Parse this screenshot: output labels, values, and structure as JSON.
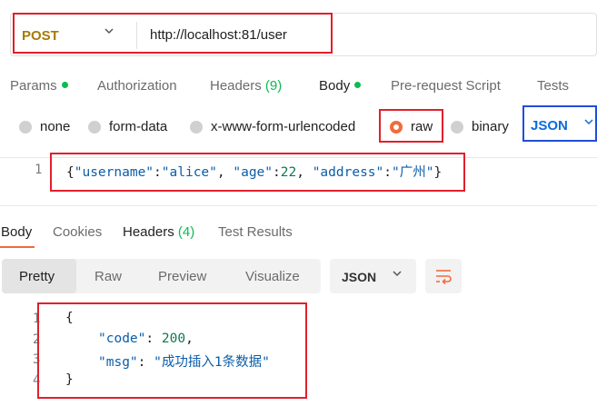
{
  "request": {
    "method": "POST",
    "url": "http://localhost:81/user"
  },
  "request_tabs": {
    "params": "Params",
    "authorization": "Authorization",
    "headers": "Headers",
    "headers_count": "(9)",
    "body": "Body",
    "prerequest": "Pre-request Script",
    "tests": "Tests"
  },
  "body_types": {
    "none": "none",
    "form_data": "form-data",
    "urlencoded": "x-www-form-urlencoded",
    "raw": "raw",
    "binary": "binary",
    "format": "JSON"
  },
  "editor": {
    "line1": "1",
    "p1": "{",
    "k1": "\"username\"",
    "c1": ":",
    "v1": "\"alice\"",
    "s1": ",",
    "k2": "\"age\"",
    "c2": ":",
    "v2": "22",
    "s2": ",",
    "k3": "\"address\"",
    "c3": ":",
    "v3": "\"广州\"",
    "p2": "}"
  },
  "response_tabs": {
    "body": "Body",
    "cookies": "Cookies",
    "headers": "Headers",
    "headers_count": "(4)",
    "test_results": "Test Results"
  },
  "response_view": {
    "pretty": "Pretty",
    "raw": "Raw",
    "preview": "Preview",
    "visualize": "Visualize",
    "format": "JSON"
  },
  "response": {
    "lines": [
      "1",
      "2",
      "3",
      "4"
    ],
    "open": "{",
    "code_key": "\"code\"",
    "code_colon": ":",
    "code_val": "200",
    "code_comma": ",",
    "msg_key": "\"msg\"",
    "msg_colon": ":",
    "msg_val": "\"成功插入1条数据\"",
    "close": "}"
  },
  "colors": {
    "highlight": "#e0202b",
    "highlight_blue": "#1f4fd6",
    "accent": "#f26b3a",
    "active_dot": "#0cbb52"
  },
  "icons": {
    "method_dropdown": "chevron-down-icon",
    "format_dropdown": "chevron-down-icon",
    "wrap": "wrap-lines-icon"
  }
}
